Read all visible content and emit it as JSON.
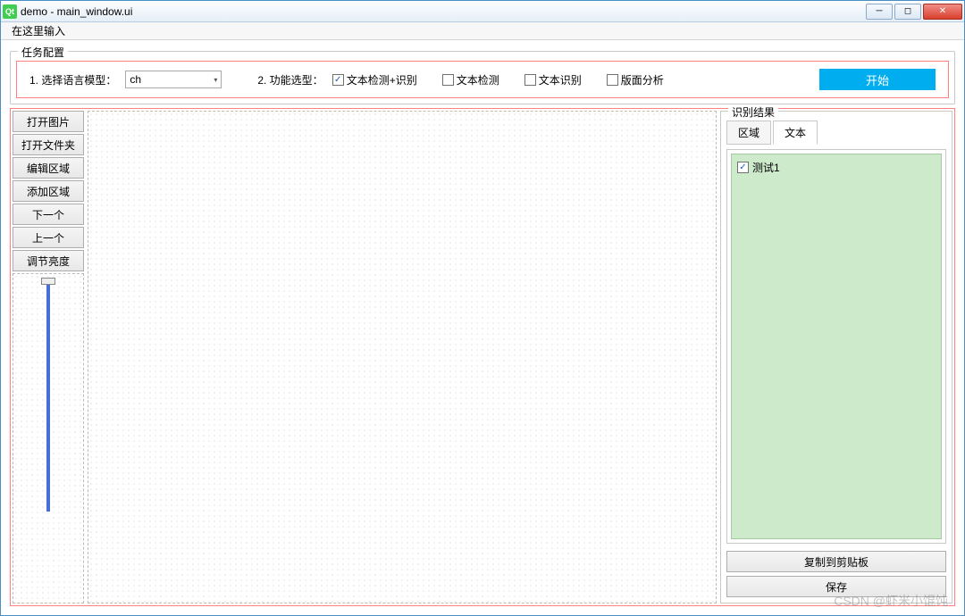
{
  "window": {
    "title": "demo - main_window.ui",
    "qt_icon": "Qt"
  },
  "menubar": {
    "placeholder": "在这里输入"
  },
  "config": {
    "group_title": "任务配置",
    "label_model": "1. 选择语言模型：",
    "combo_value": "ch",
    "label_func": "2. 功能选型：",
    "options": [
      {
        "label": "文本检测+识别",
        "checked": true
      },
      {
        "label": "文本检测",
        "checked": false
      },
      {
        "label": "文本识别",
        "checked": false
      },
      {
        "label": "版面分析",
        "checked": false
      }
    ],
    "start": "开始"
  },
  "toolbar": {
    "buttons": [
      "打开图片",
      "打开文件夹",
      "编辑区域",
      "添加区域",
      "下一个",
      "上一个",
      "调节亮度"
    ]
  },
  "results": {
    "group_title": "识别结果",
    "tabs": [
      "区域",
      "文本"
    ],
    "active_tab": 1,
    "items": [
      {
        "label": "测试1",
        "checked": true
      }
    ],
    "copy_btn": "复制到剪贴板",
    "save_btn": "保存"
  },
  "watermark": "CSDN @虾米小馄饨"
}
